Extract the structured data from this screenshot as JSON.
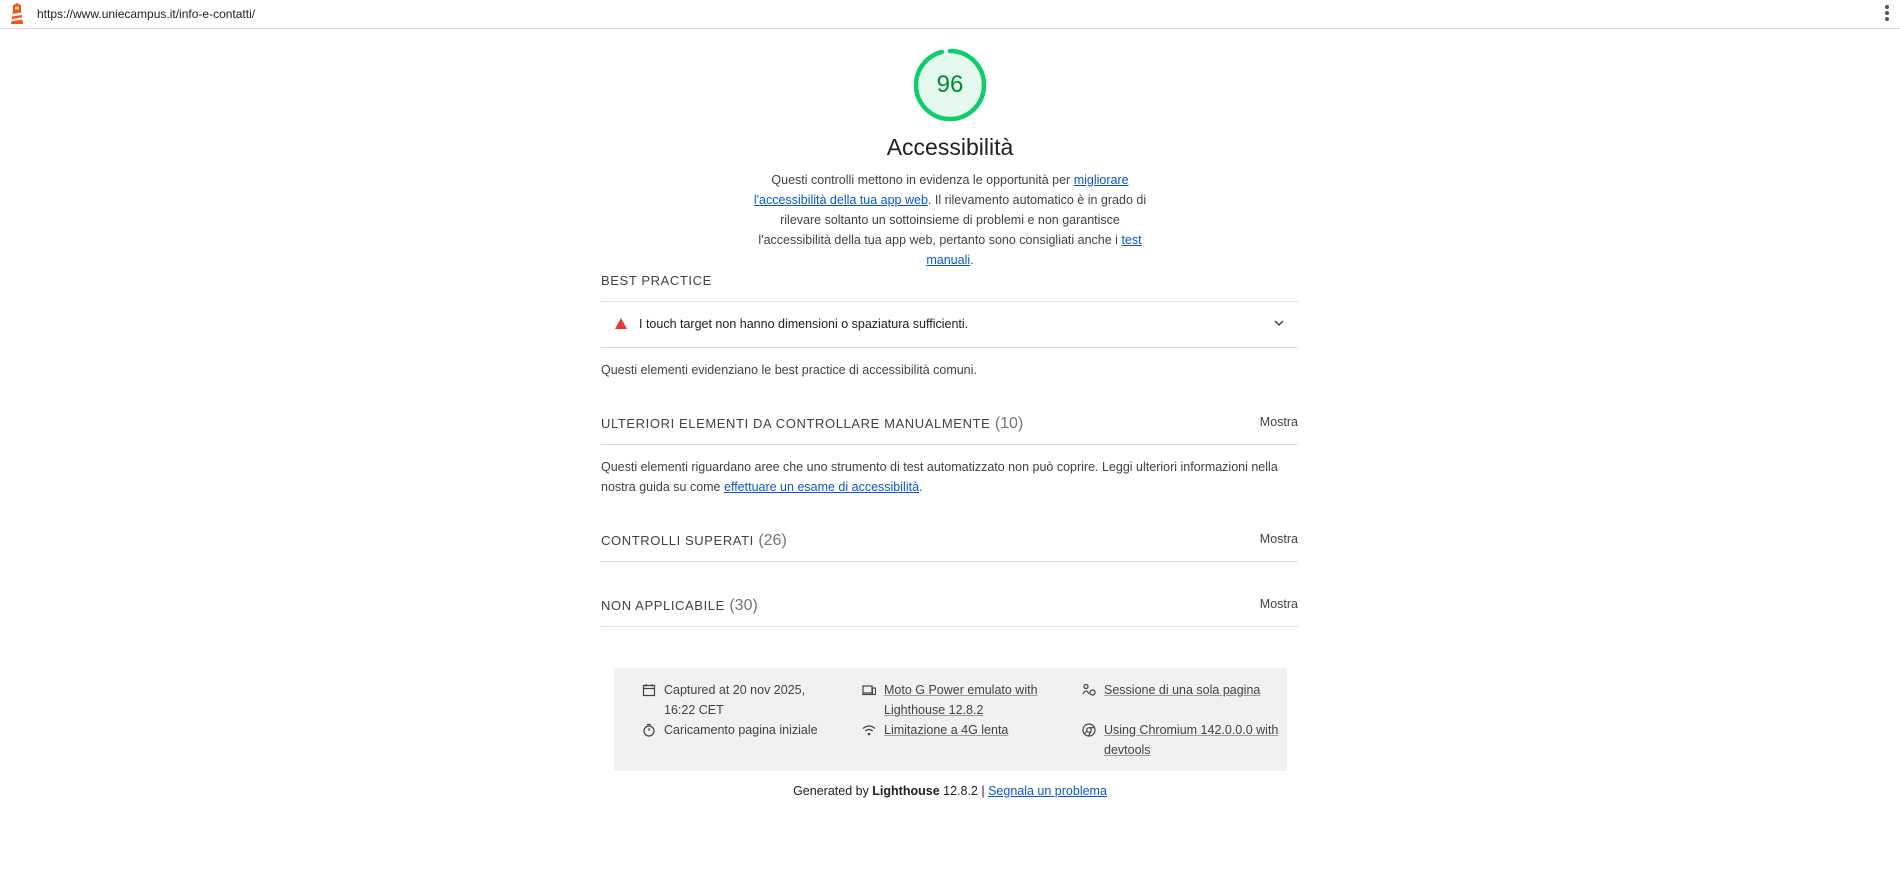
{
  "topbar": {
    "url": "https://www.uniecampus.it/info-e-contatti/"
  },
  "category": {
    "score": "96",
    "score_value": 96,
    "score_color": "#0cce6b",
    "title": "Accessibilità",
    "desc_part1": "Questi controlli mettono in evidenza le opportunità per ",
    "desc_link1": "migliorare l'accessibilità della tua app web",
    "desc_part2": ". Il rilevamento automatico è in grado di rilevare soltanto un sottoinsieme di problemi e non garantisce l'accessibilità della tua app web, pertanto sono consigliati anche i ",
    "desc_link2": "test manuali",
    "desc_part3": "."
  },
  "best_practice": {
    "heading": "BEST PRACTICE",
    "audit_title": "I touch target non hanno dimensioni o spaziatura sufficienti.",
    "description": "Questi elementi evidenziano le best practice di accessibilità comuni."
  },
  "manual": {
    "heading": "ULTERIORI ELEMENTI DA CONTROLLARE MANUALMENTE",
    "count": "(10)",
    "toggle": "Mostra",
    "desc_part1": "Questi elementi riguardano aree che uno strumento di test automatizzato non può coprire. Leggi ulteriori informazioni nella nostra guida su come ",
    "desc_link": "effettuare un esame di accessibilità",
    "desc_part2": "."
  },
  "passed": {
    "heading": "CONTROLLI SUPERATI",
    "count": "(26)",
    "toggle": "Mostra"
  },
  "not_applicable": {
    "heading": "NON APPLICABILE",
    "count": "(30)",
    "toggle": "Mostra"
  },
  "runtime": {
    "captured": "Captured at 20 nov 2025, 16:22 CET",
    "initial_load": "Caricamento pagina iniziale",
    "device": "Moto G Power emulato with Lighthouse 12.8.2",
    "throttling": "Limitazione a 4G lenta",
    "session": "Sessione di una sola pagina",
    "browser": "Using Chromium 142.0.0.0 with devtools"
  },
  "footer": {
    "generated_by": "Generated by ",
    "brand": "Lighthouse",
    "version": " 12.8.2 | ",
    "report_link": "Segnala un problema"
  }
}
